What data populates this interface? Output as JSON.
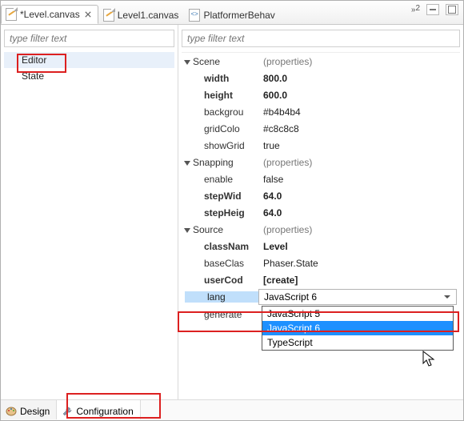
{
  "tabs": {
    "t0": {
      "label": "*Level.canvas"
    },
    "t1": {
      "label": "Level1.canvas"
    },
    "t2": {
      "label": "PlatformerBehav"
    },
    "more": "2"
  },
  "filters": {
    "left_placeholder": "type filter text",
    "right_placeholder": "type filter text"
  },
  "left_tree": {
    "item0": "Editor",
    "item1": "State"
  },
  "props": {
    "properties_label": "(properties)",
    "scene": {
      "title": "Scene",
      "width_k": "width",
      "width_v": "800.0",
      "height_k": "height",
      "height_v": "600.0",
      "bg_k": "backgrou",
      "bg_v": "#b4b4b4",
      "grid_k": "gridColo",
      "grid_v": "#c8c8c8",
      "showgrid_k": "showGrid",
      "showgrid_v": "true"
    },
    "snapping": {
      "title": "Snapping",
      "enable_k": "enable",
      "enable_v": "false",
      "stepw_k": "stepWid",
      "stepw_v": "64.0",
      "steph_k": "stepHeig",
      "steph_v": "64.0"
    },
    "source": {
      "title": "Source",
      "class_k": "classNam",
      "class_v": "Level",
      "base_k": "baseClas",
      "base_v": "Phaser.State",
      "user_k": "userCod",
      "user_v": "[create]",
      "lang_k": "lang",
      "lang_v": "JavaScript 6",
      "gen_k": "generate"
    }
  },
  "lang_options": {
    "o0": "JavaScript 5",
    "o1": "JavaScript 6",
    "o2": "TypeScript"
  },
  "page_tabs": {
    "design": "Design",
    "config": "Configuration"
  }
}
